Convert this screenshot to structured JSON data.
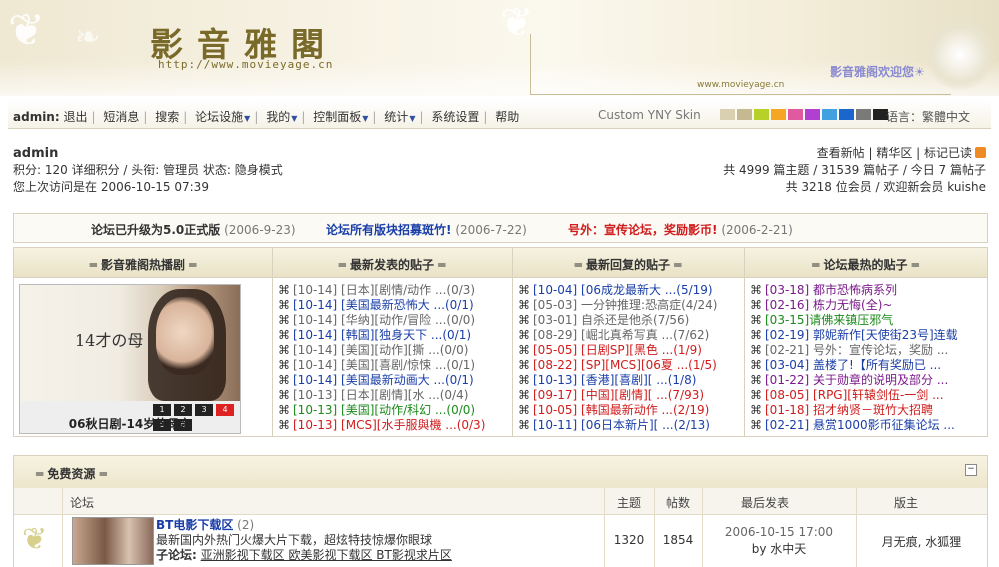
{
  "header": {
    "site_title": "影音雅閣",
    "site_url": "http://www.movieyage.cn",
    "small_url": "www.movieyage.cn",
    "welcome": "影音雅阁欢迎您☀"
  },
  "nav": {
    "user": "admin:",
    "items": [
      "退出",
      "短消息",
      "搜索",
      "论坛设施",
      "我的",
      "控制面板",
      "统计",
      "系统设置",
      "帮助"
    ],
    "skin_label": "Custom YNY Skin",
    "swatches": [
      "#d8d0b0",
      "#c6b890",
      "#b7d12a",
      "#f5a624",
      "#e05aa0",
      "#b040d0",
      "#40a0e0",
      "#1a66cc",
      "#7a7a7a",
      "#222222"
    ],
    "language": "语言：繁體中文"
  },
  "user_info": {
    "name": "admin",
    "line2": "积分: 120 详细积分 / 头衔: 管理员 状态: 隐身模式",
    "line3": "您上次访问是在 2006-10-15 07:39"
  },
  "stats": {
    "links": "查看新帖 | 精华区 | 标记已读",
    "line2": "共 4999 篇主题 / 31539 篇帖子 / 今日 7 篇帖子",
    "line3": "共 3218 位会员 / 欢迎新会员 kuishe"
  },
  "announcements": [
    {
      "title": "论坛已升级为5.0正式版",
      "date": "(2006-9-23)"
    },
    {
      "title": "论坛所有版块招募斑竹!",
      "date": "(2006-7-22)"
    },
    {
      "title": "号外：宣传论坛，奖励影币!",
      "date": "(2006-2-21)"
    }
  ],
  "panel": {
    "headers": [
      "═ 影音雅阁热播剧 ═",
      "═ 最新发表的贴子 ═",
      "═ 最新回复的贴子 ═",
      "═ 论坛最热的贴子 ═"
    ],
    "photo_text": "14才の母",
    "photo_pages": [
      "1",
      "2",
      "3",
      "4",
      "5",
      "6"
    ],
    "photo_caption": "06秋日剧-14岁的母亲",
    "bullet": "⌘",
    "new_posts": [
      {
        "t": "[10-14] [日本][剧情/动作 ...(0/3)",
        "c": "g"
      },
      {
        "t": "[10-14] [美国最新恐怖大 ...(0/1)",
        "c": "b"
      },
      {
        "t": "[10-14] [华纳][动作/冒险 ...(0/0)",
        "c": "g"
      },
      {
        "t": "[10-14] [韩国][独身天下 ...(0/1)",
        "c": "b"
      },
      {
        "t": "[10-14] [美国][动作][撕 ...(0/0)",
        "c": "g"
      },
      {
        "t": "[10-14] [美国][喜剧/惊悚 ...(0/1)",
        "c": "g"
      },
      {
        "t": "[10-14] [美国最新动画大 ...(0/1)",
        "c": "b"
      },
      {
        "t": "[10-13] [日本][剧情][水 ...(0/4)",
        "c": "g"
      },
      {
        "t": "[10-13] [美国][动作/科幻 ...(0/0)",
        "c": "gr"
      },
      {
        "t": "[10-13] [MCS][水手服與機 ...(0/3)",
        "c": "r"
      }
    ],
    "new_replies": [
      {
        "t": "[10-04] [06成龙最新大 ...(5/19)",
        "c": "b"
      },
      {
        "t": "[05-03] 一分钟推理:恐高症(4/24)",
        "c": "g"
      },
      {
        "t": "[03-01] 自杀还是他杀(7/56)",
        "c": "g"
      },
      {
        "t": "[08-29] [崛北真希写真 ...(7/62)",
        "c": "g"
      },
      {
        "t": "[05-05] [日剧SP][黑色 ...(1/9)",
        "c": "r"
      },
      {
        "t": "[08-22] [SP][MCS][06夏 ...(1/5)",
        "c": "r"
      },
      {
        "t": "[10-13] [香港][喜剧][ ...(1/8)",
        "c": "b"
      },
      {
        "t": "[09-17] [中国][剧情][ ...(7/93)",
        "c": "r"
      },
      {
        "t": "[10-05] [韩国最新动作 ...(2/19)",
        "c": "r"
      },
      {
        "t": "[10-11] [06日本新片][ ...(2/13)",
        "c": "b"
      }
    ],
    "hot_posts": [
      {
        "t": "[03-18] 都市恐怖病系列",
        "c": "p"
      },
      {
        "t": "[02-16] 栋力无悔(全)~",
        "c": "p"
      },
      {
        "t": "[03-15]请佛来镇压邪气",
        "c": "gr"
      },
      {
        "t": "[02-19] 郭妮新作[天使街23号]连载",
        "c": "b"
      },
      {
        "t": "[02-21] 号外：宣传论坛，奖励 ...",
        "c": "g"
      },
      {
        "t": "[03-04] 盖楼了!【所有奖励已 ...",
        "c": "b"
      },
      {
        "t": "[01-22] 关于勋章的说明及部分 ...",
        "c": "p"
      },
      {
        "t": "[08-05] [RPG][轩辕剑伍-一剑 ...",
        "c": "r"
      },
      {
        "t": "[01-18] 招才纳贤－斑竹大招聘",
        "c": "r"
      },
      {
        "t": "[02-21] 悬赏1000影币征集论坛 ...",
        "c": "b"
      }
    ]
  },
  "forum": {
    "category": "═ 免费资源 ═",
    "collapse": "−",
    "columns": [
      "论坛",
      "主题",
      "帖数",
      "最后发表",
      "版主"
    ],
    "row": {
      "name": "BT电影下载区",
      "today": "(2)",
      "desc": "最新国内外热门火爆大片下载，超炫特技惊爆你眼球",
      "sub_label": "子论坛:",
      "subs": "亚洲影视下载区  欧美影视下载区  BT影视求片区",
      "topics": "1320",
      "posts": "1854",
      "last_time": "2006-10-15 17:00",
      "last_by": "by 水中天",
      "mods": "月无痕, 水狐狸"
    }
  }
}
